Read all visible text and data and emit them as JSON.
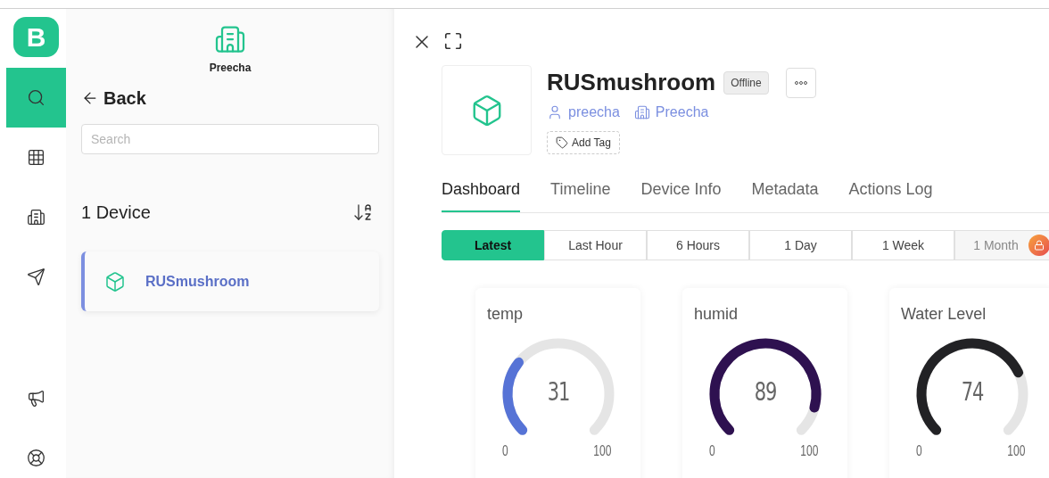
{
  "rail": {
    "logo": "B",
    "items": [
      {
        "selected": true
      },
      {
        "selected": false
      },
      {
        "selected": false
      },
      {
        "selected": false
      },
      {
        "selected": false
      },
      {
        "selected": false
      }
    ]
  },
  "sidebar": {
    "org": "Preecha",
    "back": "Back",
    "search": {
      "placeholder": "Search"
    },
    "count": "1 Device",
    "devices": [
      {
        "name": "RUSmushroom",
        "selected": true
      }
    ]
  },
  "device": {
    "name": "RUSmushroom",
    "status": "Offline",
    "owner": "preecha",
    "org": "Preecha",
    "add_tag": "Add Tag"
  },
  "tabs": [
    {
      "label": "Dashboard",
      "selected": true
    },
    {
      "label": "Timeline",
      "selected": false
    },
    {
      "label": "Device Info",
      "selected": false
    },
    {
      "label": "Metadata",
      "selected": false
    },
    {
      "label": "Actions Log",
      "selected": false
    }
  ],
  "ranges": [
    {
      "label": "Latest",
      "selected": true,
      "locked": false
    },
    {
      "label": "Last Hour",
      "selected": false,
      "locked": false
    },
    {
      "label": "6 Hours",
      "selected": false,
      "locked": false
    },
    {
      "label": "1 Day",
      "selected": false,
      "locked": false
    },
    {
      "label": "1 Week",
      "selected": false,
      "locked": false
    },
    {
      "label": "1 Month",
      "selected": false,
      "locked": true
    }
  ],
  "gauges": [
    {
      "title": "temp",
      "value": "31",
      "min": "0",
      "max": "100",
      "color": "#5673d6"
    },
    {
      "title": "humid",
      "value": "89",
      "min": "0",
      "max": "100",
      "color": "#2e1150"
    },
    {
      "title": "Water Level",
      "value": "74",
      "min": "0",
      "max": "100",
      "color": "#222225"
    }
  ]
}
